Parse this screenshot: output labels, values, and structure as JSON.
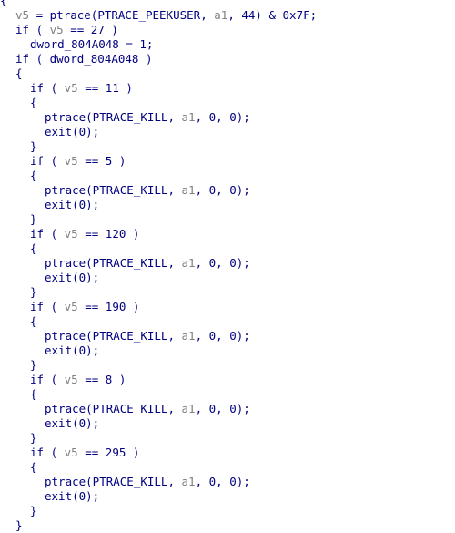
{
  "code": {
    "open_brace_top": "{",
    "assign_v5": {
      "var": "v5",
      "rest": " = ptrace(PTRACE_PEEKUSER, ",
      "arg": "a1",
      "tail": ", 44) & 0x7F;"
    },
    "if_27": {
      "pre": "if ( ",
      "var": "v5",
      "post": " == 27 )"
    },
    "set_dword": "dword_804A048 = 1;",
    "if_dword": "if ( dword_804A048 )",
    "outer_open": "{",
    "outer_close": "}",
    "blocks": [
      {
        "pre": "if ( ",
        "var": "v5",
        "post": " == 11 )"
      },
      {
        "pre": "if ( ",
        "var": "v5",
        "post": " == 5 )"
      },
      {
        "pre": "if ( ",
        "var": "v5",
        "post": " == 120 )"
      },
      {
        "pre": "if ( ",
        "var": "v5",
        "post": " == 190 )"
      },
      {
        "pre": "if ( ",
        "var": "v5",
        "post": " == 8 )"
      },
      {
        "pre": "if ( ",
        "var": "v5",
        "post": " == 295 )"
      }
    ],
    "block_open": "{",
    "block_close": "}",
    "kill": {
      "pre": "ptrace(PTRACE_KILL, ",
      "arg": "a1",
      "post": ", 0, 0);"
    },
    "exit": "exit(0);"
  }
}
